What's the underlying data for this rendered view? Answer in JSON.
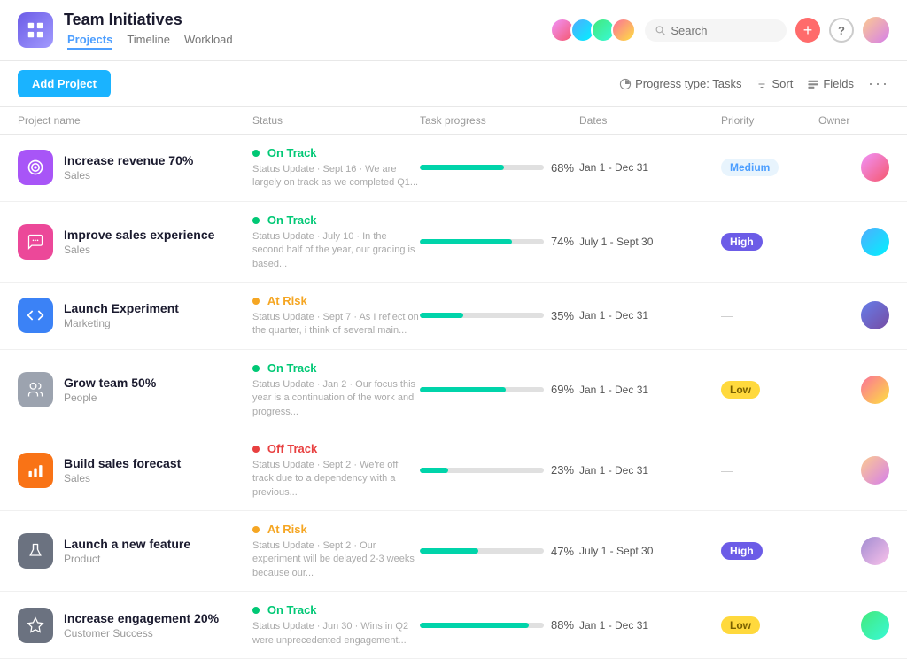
{
  "app": {
    "title": "Team Initiatives",
    "nav_tabs": [
      "Projects",
      "Timeline",
      "Workload"
    ]
  },
  "toolbar": {
    "add_project_label": "Add Project",
    "progress_type_label": "Progress type: Tasks",
    "sort_label": "Sort",
    "fields_label": "Fields"
  },
  "table": {
    "headers": [
      "Project name",
      "Status",
      "Task progress",
      "Dates",
      "Priority",
      "Owner"
    ],
    "projects": [
      {
        "id": 1,
        "name": "Increase revenue 70%",
        "category": "Sales",
        "icon_type": "target",
        "icon_color": "purple",
        "status": "On Track",
        "status_type": "on_track",
        "status_update": "Status Update · Sept 16 · We are largely on track as we completed Q1...",
        "progress": 68,
        "dates": "Jan 1 - Dec 31",
        "priority": "Medium",
        "priority_type": "medium",
        "owner_color": "av1"
      },
      {
        "id": 2,
        "name": "Improve sales experience",
        "category": "Sales",
        "icon_type": "chat",
        "icon_color": "pink",
        "status": "On Track",
        "status_type": "on_track",
        "status_update": "Status Update · July 10 · In the second half of the year, our grading is based...",
        "progress": 74,
        "dates": "July 1 - Sept 30",
        "priority": "High",
        "priority_type": "high",
        "owner_color": "av2"
      },
      {
        "id": 3,
        "name": "Launch Experiment",
        "category": "Marketing",
        "icon_type": "code",
        "icon_color": "blue",
        "status": "At Risk",
        "status_type": "at_risk",
        "status_update": "Status Update · Sept 7 · As I reflect on the quarter, i think of several main...",
        "progress": 35,
        "dates": "Jan 1 - Dec 31",
        "priority": "",
        "priority_type": "none",
        "owner_color": "av3"
      },
      {
        "id": 4,
        "name": "Grow team 50%",
        "category": "People",
        "icon_type": "people",
        "icon_color": "gray",
        "status": "On Track",
        "status_type": "on_track",
        "status_update": "Status Update · Jan 2 · Our focus this year is a continuation of the work and progress...",
        "progress": 69,
        "dates": "Jan 1 - Dec 31",
        "priority": "Low",
        "priority_type": "low",
        "owner_color": "av4"
      },
      {
        "id": 5,
        "name": "Build sales forecast",
        "category": "Sales",
        "icon_type": "bars",
        "icon_color": "orange",
        "status": "Off Track",
        "status_type": "off_track",
        "status_update": "Status Update · Sept 2 · We're off track due to a dependency with a previous...",
        "progress": 23,
        "dates": "Jan 1 - Dec 31",
        "priority": "",
        "priority_type": "none",
        "owner_color": "av5"
      },
      {
        "id": 6,
        "name": "Launch a new feature",
        "category": "Product",
        "icon_type": "flask",
        "icon_color": "dark",
        "status": "At Risk",
        "status_type": "at_risk",
        "status_update": "Status Update · Sept 2 · Our experiment will be delayed 2-3 weeks because our...",
        "progress": 47,
        "dates": "July 1 - Sept 30",
        "priority": "High",
        "priority_type": "high",
        "owner_color": "av6"
      },
      {
        "id": 7,
        "name": "Increase engagement 20%",
        "category": "Customer Success",
        "icon_type": "star",
        "icon_color": "star",
        "status": "On Track",
        "status_type": "on_track",
        "status_update": "Status Update · Jun 30 · Wins in Q2 were unprecedented engagement...",
        "progress": 88,
        "dates": "Jan 1 - Dec 31",
        "priority": "Low",
        "priority_type": "low",
        "owner_color": "av7"
      }
    ]
  }
}
